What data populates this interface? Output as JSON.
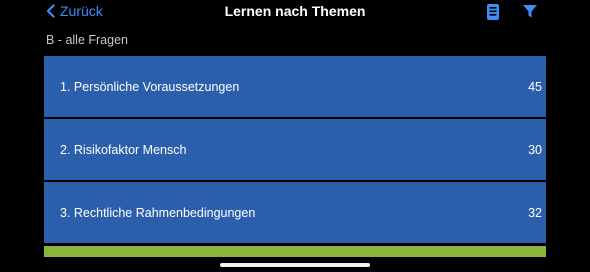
{
  "nav": {
    "back_label": "Zurück",
    "title": "Lernen nach Themen",
    "accent_color": "#3d8ef5"
  },
  "section": {
    "label": "B - alle Fragen"
  },
  "topics": [
    {
      "label": "1. Persönliche Voraussetzungen",
      "count": "45"
    },
    {
      "label": "2. Risikofaktor Mensch",
      "count": "30"
    },
    {
      "label": "3. Rechtliche Rahmenbedingungen",
      "count": "32"
    }
  ],
  "colors": {
    "row_background": "#2b5fab",
    "bottom_bar": "#8cb33c"
  },
  "icons": [
    "chevron-left-icon",
    "list-document-icon",
    "filter-funnel-icon"
  ]
}
